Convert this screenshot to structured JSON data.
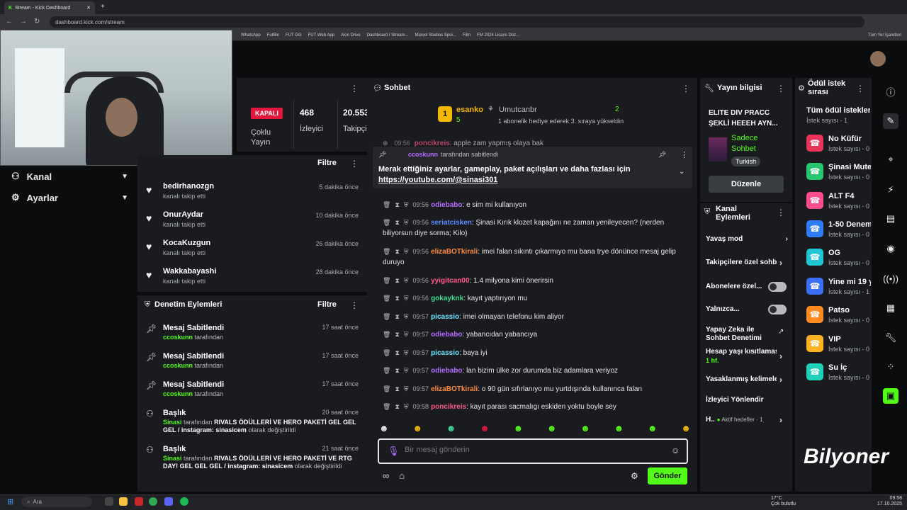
{
  "browser": {
    "tab_title": "Stream - Kick Dashboard",
    "url": "dashboard.kick.com/stream",
    "bookmarks": [
      "WhatsApp",
      "FutBin",
      "FUT GG",
      "FUT Web App",
      "Akın Drive",
      "Dashboard / Stream...",
      "Marvel Studios Spoi...",
      "Film",
      "FM 2024 Lisans Düz...",
      "Tüm Yer İşaretleri"
    ]
  },
  "left_nav": {
    "items": [
      {
        "label": "Kanal",
        "icon": "channel-icon"
      },
      {
        "label": "Ayarlar",
        "icon": "gear-icon"
      }
    ]
  },
  "stats": {
    "status_badge": "KAPALI",
    "status_label": "Çoklu Yayın",
    "viewers_value": "468",
    "viewers_label": "İzleyici",
    "followers_value": "20.553",
    "followers_label": "Takipçi"
  },
  "followers_panel": {
    "filter_label": "Filtre",
    "items": [
      {
        "name": "bedirhanozgn",
        "action": "kanalı takip etti",
        "time": "5 dakika önce"
      },
      {
        "name": "OnurAydar",
        "action": "kanalı takip etti",
        "time": "10 dakika önce"
      },
      {
        "name": "KocaKuzgun",
        "action": "kanalı takip etti",
        "time": "26 dakika önce"
      },
      {
        "name": "Wakkabayashi",
        "action": "kanalı takip etti",
        "time": "28 dakika önce"
      }
    ]
  },
  "moderation": {
    "title": "Denetim Eylemleri",
    "filter_label": "Filtre",
    "items": [
      {
        "title": "Mesaj Sabitlendi",
        "user": "ccoskunn",
        "suffix": "tarafından",
        "time": "17 saat önce",
        "icon": "pin-icon"
      },
      {
        "title": "Mesaj Sabitlendi",
        "user": "ccoskunn",
        "suffix": "tarafından",
        "time": "17 saat önce",
        "icon": "pin-icon"
      },
      {
        "title": "Mesaj Sabitlendi",
        "user": "ccoskunn",
        "suffix": "tarafından",
        "time": "17 saat önce",
        "icon": "pin-icon"
      },
      {
        "title": "Başlık",
        "user": "Sinasi",
        "by": "tarafından",
        "content": "RIVALS ÖDÜLLERİ VE HERO PAKETİ GEL GEL GEL / instagram: sinasicem",
        "suffix": "olarak değiştirildi",
        "time": "20 saat önce",
        "icon": "user-edit-icon"
      },
      {
        "title": "Başlık",
        "user": "Sinasi",
        "by": "tarafından",
        "content": "RIVALS ÖDÜLLERİ VE HERO PAKETİ VE RTG DAY! GEL GEL GEL / instagram: sinasicem",
        "suffix": "olarak değiştirildi",
        "time": "21 saat önce",
        "icon": "user-edit-icon"
      }
    ]
  },
  "chat": {
    "title": "Sohbet",
    "top_gifter": {
      "rank": "1",
      "name": "esanko",
      "count": "5"
    },
    "gift_banner": {
      "name": "Umutcanbr",
      "count": "2",
      "text": "1 abonelik hediye ederek 3. sıraya yükseldin"
    },
    "pinned": {
      "by_user": "ccoskunn",
      "by_suffix": "tarafından sabitlendi",
      "text": "Merak ettiğiniz ayarlar, gameplay, paket açılışları ve daha fazlası için",
      "link": "https://youtube.com/@sinasi301"
    },
    "messages": [
      {
        "time": "09:56",
        "user": "odiebabo",
        "color": "#b36cff",
        "text": "e sim mi kullanıyon"
      },
      {
        "time": "09:56",
        "user": "seriatcisken",
        "color": "#5b8dff",
        "text": "Şinasi Kırık klozet kapağını ne zaman yenileyecen? (nerden biliyorsun diye sorma; Kilo)"
      },
      {
        "time": "09:56",
        "user": "elizaBOTkirali",
        "color": "#ff8a3d",
        "text": "imei falan sıkıntı çıkarmıyo mu bana trye dönünce mesaj gelip duruyo"
      },
      {
        "time": "09:56",
        "user": "yyigitcan00",
        "color": "#ff5a8a",
        "text": "1.4 milyona kimi önerirsin"
      },
      {
        "time": "09:56",
        "user": "gokayknk",
        "color": "#3ddc97",
        "text": "kayıt yaptırıyon mu"
      },
      {
        "time": "09:57",
        "user": "picassio",
        "color": "#6ee7ff",
        "text": "imei olmayan telefonu kim aliyor"
      },
      {
        "time": "09:57",
        "user": "odiebabo",
        "color": "#b36cff",
        "text": "yabancıdan yabancıya"
      },
      {
        "time": "09:57",
        "user": "picassio",
        "color": "#6ee7ff",
        "text": "baya iyi"
      },
      {
        "time": "09:57",
        "user": "odiebabo",
        "color": "#b36cff",
        "text": "lan bizim ülke zor durumda biz adamlara veriyoz"
      },
      {
        "time": "09:57",
        "user": "elizaBOTkirali",
        "color": "#ff8a3d",
        "text": "o 90 gün sıfırlanıyo mu yurtdışında kullanınca falan"
      },
      {
        "time": "09:58",
        "user": "poncikreis",
        "color": "#ff5a8a",
        "text": "kayıt parası sacmalıgı eskiden yoktu boyle sey"
      }
    ],
    "partial_top": {
      "time": "09:56",
      "user": "poncikreis",
      "text": "apple zam yapmış olaya bak"
    },
    "input_placeholder": "Bir mesaj gönderin",
    "send_label": "Gönder"
  },
  "stream_info": {
    "title": "Yayın bilgisi",
    "stream_title": "ELITE DIV PRACC ŞEKLİ HEEEH AYN...",
    "category": "Sadece Sohbet",
    "language": "Turkish",
    "edit_label": "Düzenle"
  },
  "channel_actions": {
    "title": "Kanal Eylemleri",
    "items": [
      {
        "label": "Yavaş mod",
        "control": "arrow"
      },
      {
        "label": "Takipçilere özel sohbet",
        "control": "arrow"
      },
      {
        "label": "Abonelere özel...",
        "control": "toggle"
      },
      {
        "label": "Yalnızca...",
        "control": "toggle"
      },
      {
        "label": "Yapay Zeka ile Sohbet Denetimi",
        "control": "external"
      },
      {
        "label": "Hesap yaşı kısıtlaması",
        "sub": "1 hf.",
        "control": "arrow"
      },
      {
        "label": "Yasaklanmış kelimeler",
        "control": "arrow"
      },
      {
        "label": "İzleyici Yönlendir",
        "control": "none"
      },
      {
        "label": "H..",
        "sub": "Aktif hedefler · 1",
        "control": "arrow"
      }
    ]
  },
  "rewards": {
    "title": "Ödül istek sırası",
    "all_label": "Tüm ödül istekleri",
    "all_sub": "İstek sayısı - 1",
    "items": [
      {
        "name": "No Küfür",
        "sub": "İstek sayısı - 0",
        "color": "#e8345a"
      },
      {
        "name": "Şinasi Mute",
        "sub": "İstek sayısı - 0",
        "color": "#28c76f"
      },
      {
        "name": "ALT F4",
        "sub": "İstek sayısı - 0",
        "color": "#ff4d8d"
      },
      {
        "name": "1-50 Denem",
        "sub": "İstek sayısı - 0",
        "color": "#2f7cf6"
      },
      {
        "name": "OG",
        "sub": "İstek sayısı - 0",
        "color": "#1fc7d4"
      },
      {
        "name": "Yine mi 19 y",
        "sub": "İstek sayısı - 1",
        "color": "#3b6ff5"
      },
      {
        "name": "Patso",
        "sub": "İstek sayısı - 0",
        "color": "#ff8a1f"
      },
      {
        "name": "VIP",
        "sub": "İstek sayısı - 0",
        "color": "#ffb21f"
      },
      {
        "name": "Su İç",
        "sub": "İstek sayısı - 0",
        "color": "#1fd1b8"
      }
    ]
  },
  "taskbar": {
    "search_label": "Ara",
    "weather_temp": "17°C",
    "weather_text": "Çok bulutlu",
    "time": "09:58",
    "date": "17.10.2025"
  },
  "brand_text": "Bilyoner"
}
